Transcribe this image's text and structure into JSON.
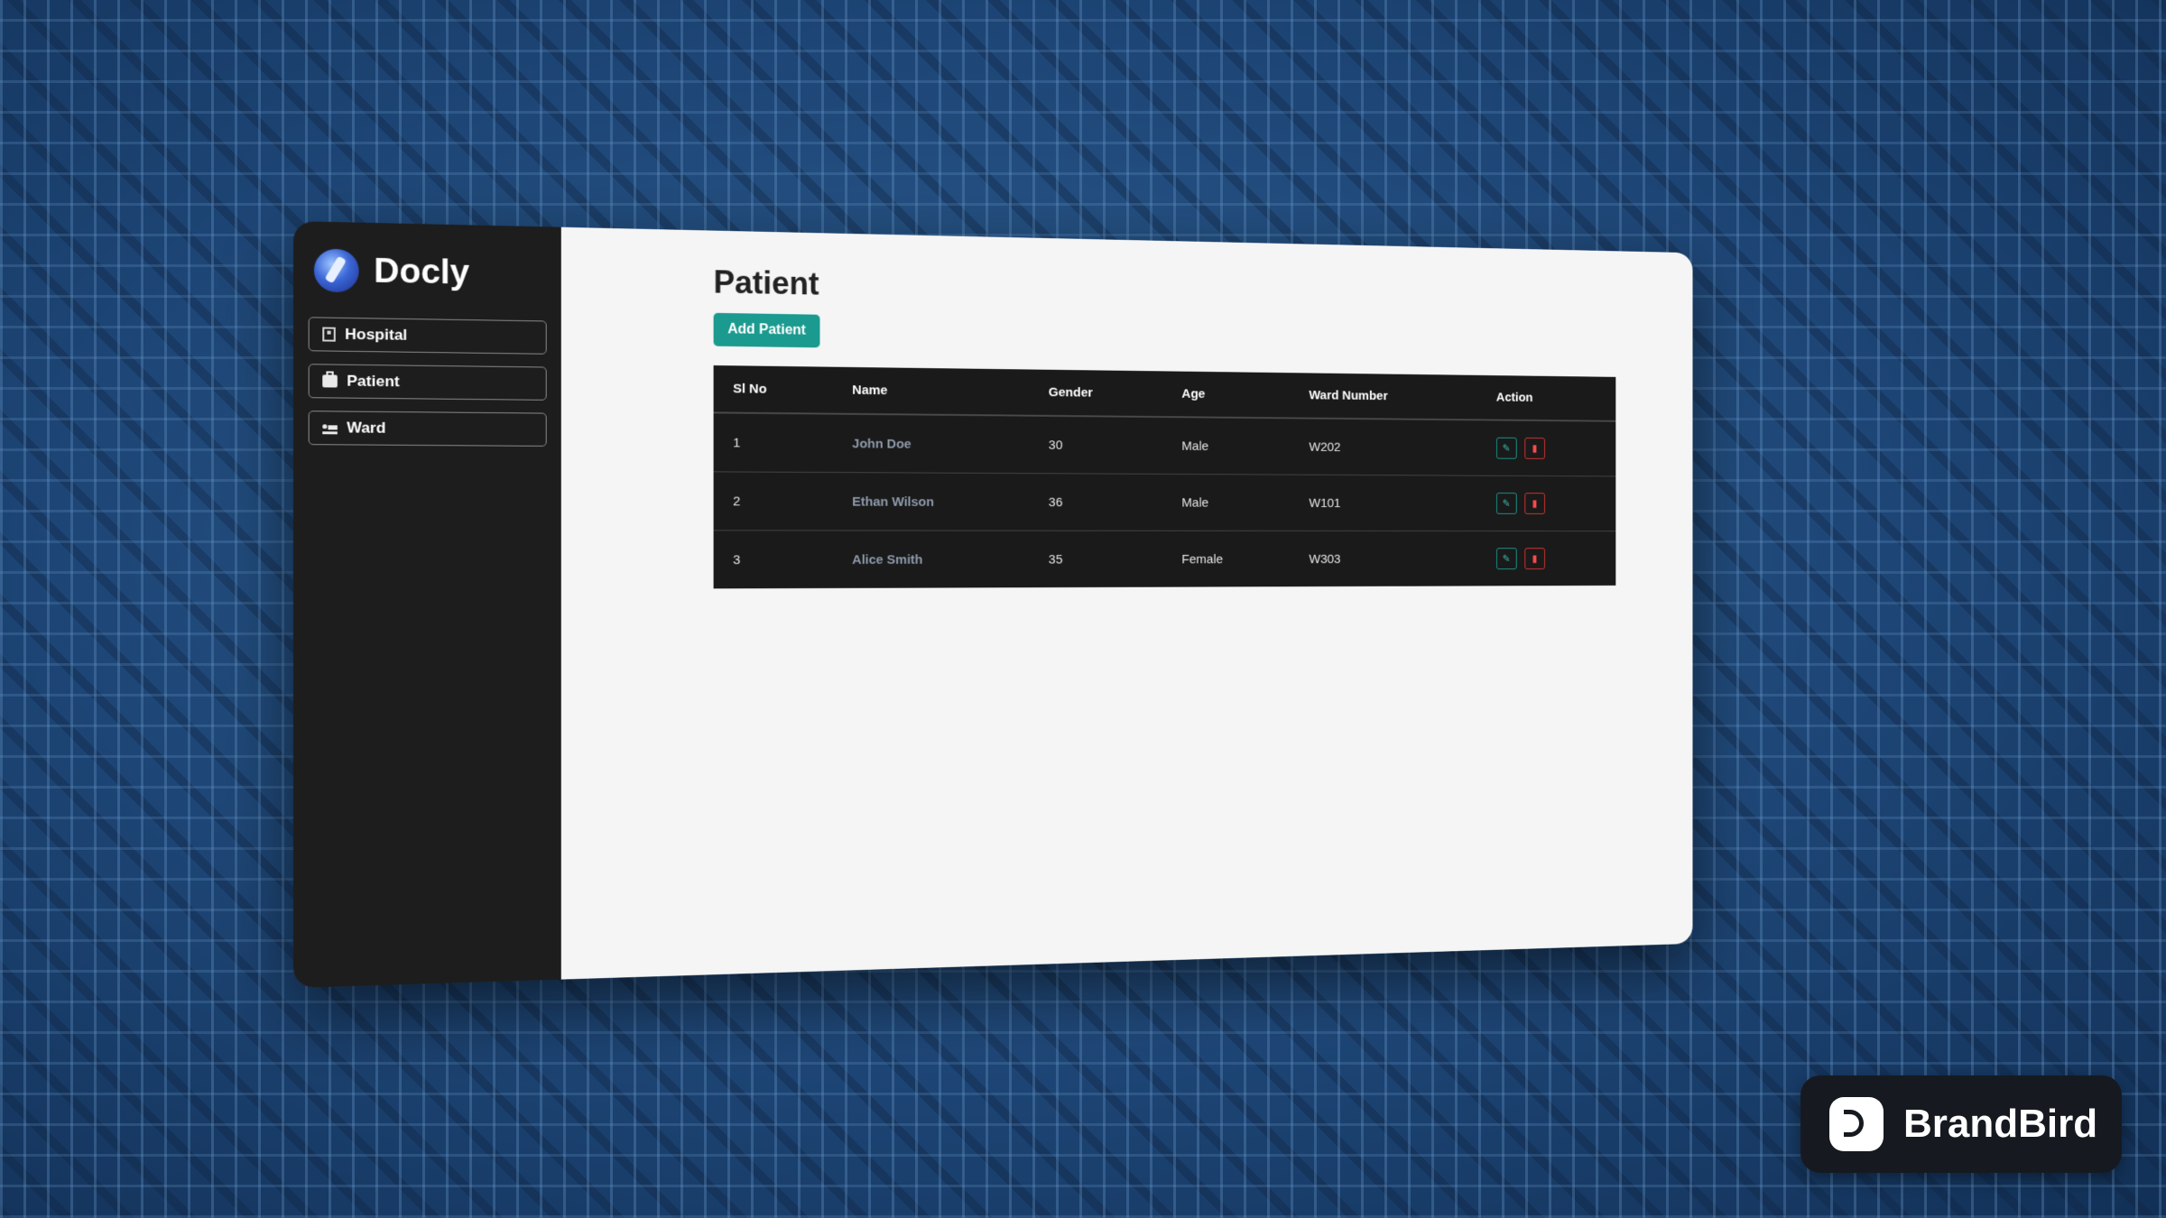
{
  "app": {
    "brand": "Docly"
  },
  "sidebar": {
    "items": [
      {
        "label": "Hospital",
        "icon": "hospital-icon"
      },
      {
        "label": "Patient",
        "icon": "briefcase-medical-icon"
      },
      {
        "label": "Ward",
        "icon": "bed-icon"
      }
    ]
  },
  "main": {
    "title": "Patient",
    "add_button_label": "Add Patient",
    "table": {
      "columns": [
        "Sl No",
        "Name",
        "Gender",
        "Age",
        "Ward Number",
        "Action"
      ],
      "rows": [
        {
          "sl_no": "1",
          "name": "John Doe",
          "gender": "30",
          "age": "Male",
          "ward": "W202"
        },
        {
          "sl_no": "2",
          "name": "Ethan Wilson",
          "gender": "36",
          "age": "Male",
          "ward": "W101"
        },
        {
          "sl_no": "3",
          "name": "Alice Smith",
          "gender": "35",
          "age": "Female",
          "ward": "W303"
        }
      ]
    }
  },
  "watermark": {
    "text": "BrandBird"
  },
  "colors": {
    "accent": "#1b9a8f",
    "danger": "#dd3333",
    "sidebar_bg": "#1d1d1d",
    "table_bg": "#1a1a1a"
  }
}
